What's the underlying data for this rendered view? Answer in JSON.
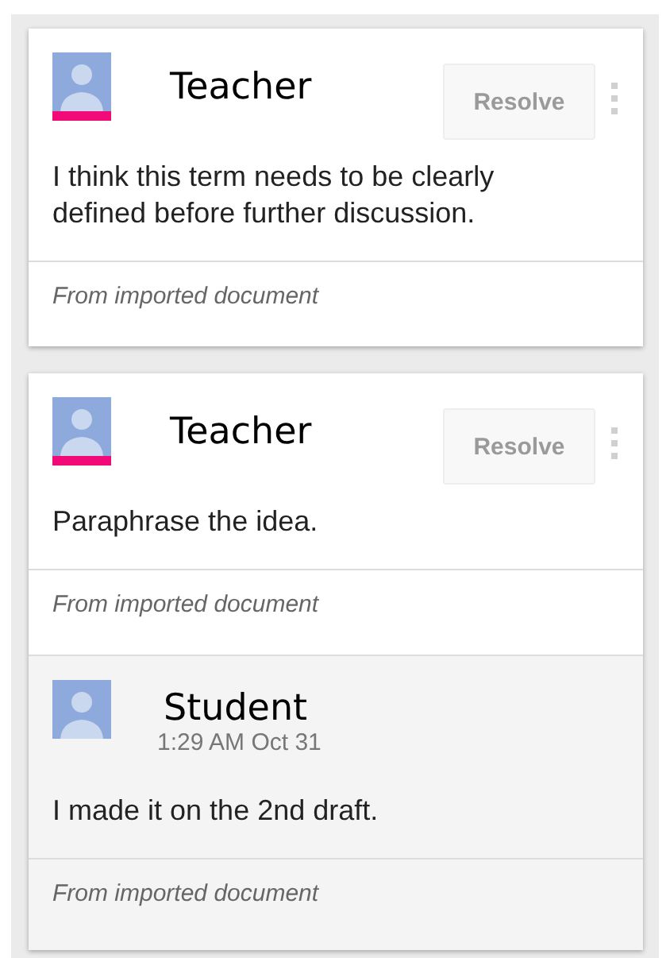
{
  "threads": [
    {
      "resolve_label": "Resolve",
      "comments": [
        {
          "kind": "comment",
          "author": "Teacher",
          "flagged": true,
          "body": "I think this term needs to be clearly defined before further discussion.",
          "source": "From imported document"
        }
      ]
    },
    {
      "resolve_label": "Resolve",
      "comments": [
        {
          "kind": "comment",
          "author": "Teacher",
          "flagged": true,
          "body": "Paraphrase the idea.",
          "source": "From imported document"
        },
        {
          "kind": "reply",
          "author": "Student",
          "time": "1:29 AM Oct 31",
          "flagged": false,
          "body": "I made it on the 2nd draft.",
          "source": "From imported document"
        }
      ]
    }
  ]
}
